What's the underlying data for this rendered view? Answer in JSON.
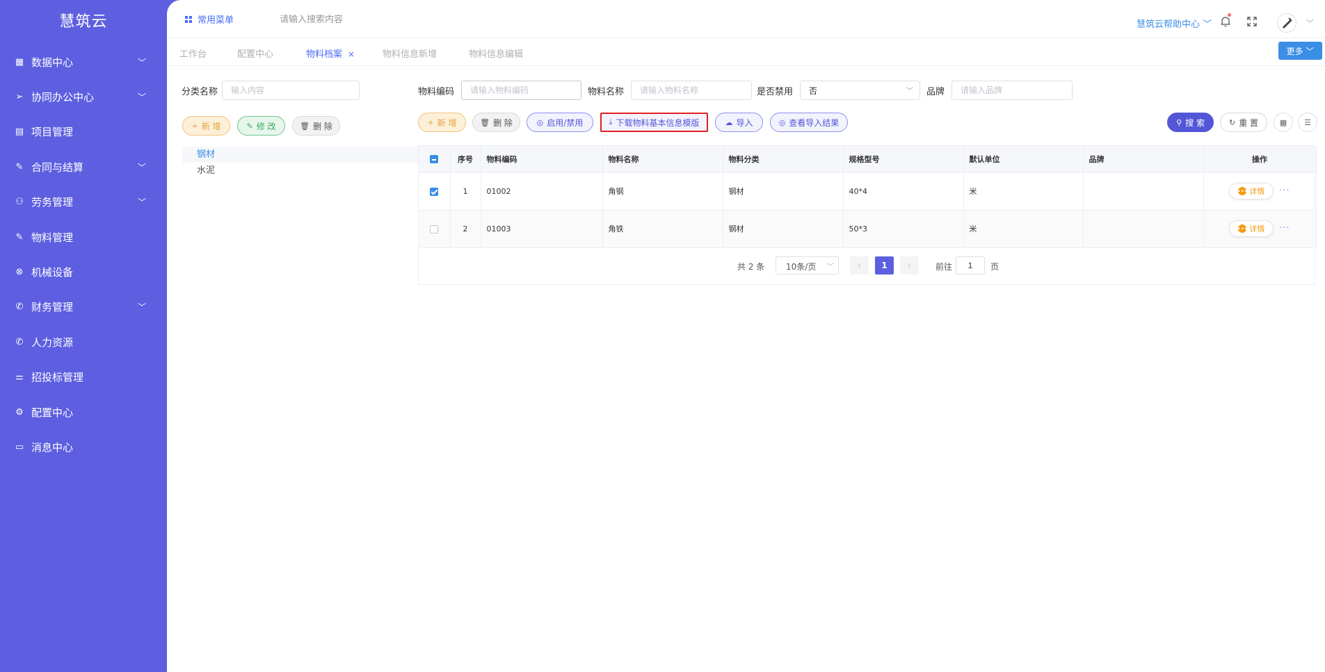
{
  "brand": "慧筑云",
  "sidebar": {
    "items": [
      {
        "label": "数据中心",
        "icon": "grid-icon",
        "glyph": "▦",
        "arrow": true
      },
      {
        "label": "协同办公中心",
        "icon": "send-icon",
        "glyph": "➢",
        "arrow": true
      },
      {
        "label": "项目管理",
        "icon": "book-icon",
        "glyph": "▤",
        "arrow": false
      },
      {
        "label": "合同与结算",
        "icon": "edit-icon",
        "glyph": "✎",
        "arrow": true
      },
      {
        "label": "劳务管理",
        "icon": "user-icon",
        "glyph": "⚇",
        "arrow": true
      },
      {
        "label": "物料管理",
        "icon": "edit-icon",
        "glyph": "✎",
        "arrow": false
      },
      {
        "label": "机械设备",
        "icon": "close-circle-icon",
        "glyph": "⊗",
        "arrow": false
      },
      {
        "label": "财务管理",
        "icon": "phone-icon",
        "glyph": "✆",
        "arrow": true
      },
      {
        "label": "人力资源",
        "icon": "phone-icon",
        "glyph": "✆",
        "arrow": false
      },
      {
        "label": "招投标管理",
        "icon": "sliders-icon",
        "glyph": "⚌",
        "arrow": false
      },
      {
        "label": "配置中心",
        "icon": "gear-icon",
        "glyph": "⚙",
        "arrow": false
      },
      {
        "label": "消息中心",
        "icon": "message-icon",
        "glyph": "▭",
        "arrow": false
      }
    ]
  },
  "topbar": {
    "common_menu": "常用菜单",
    "search_placeholder": "请输入搜索内容",
    "help": "慧筑云帮助中心 ﹀"
  },
  "tabs": [
    {
      "label": "工作台",
      "active": false
    },
    {
      "label": "配置中心",
      "active": false
    },
    {
      "label": "物料档案",
      "active": true,
      "closable": true
    },
    {
      "label": "物料信息新增",
      "active": false
    },
    {
      "label": "物料信息编辑",
      "active": false
    }
  ],
  "tab_close": "×",
  "more_button": "更多 ﹀",
  "left": {
    "filter_label": "分类名称",
    "filter_placeholder": "输入内容",
    "add": "新 增",
    "edit": "修 改",
    "delete": "删 除",
    "tree": [
      "钢材",
      "水泥"
    ]
  },
  "filters": {
    "code_label": "物料编码",
    "code_placeholder": "请输入物料编码",
    "name_label": "物料名称",
    "name_placeholder": "请输入物料名称",
    "disabled_label": "是否禁用",
    "disabled_value": "否",
    "brand_label": "品牌",
    "brand_placeholder": "请输入品牌"
  },
  "toolbar": {
    "add": "新 增",
    "delete": "删 除",
    "toggle": "启用/禁用",
    "download": "下载物料基本信息模版",
    "import": "导入",
    "view_import": "查看导入结果",
    "search": "搜 索",
    "reset": "重 置"
  },
  "table": {
    "headers": [
      "序号",
      "物料编码",
      "物料名称",
      "物料分类",
      "规格型号",
      "默认单位",
      "品牌",
      "操作"
    ],
    "rows": [
      {
        "index": "1",
        "code": "01002",
        "name": "角钢",
        "category": "钢材",
        "spec": "40*4",
        "unit": "米",
        "brand": "",
        "checked": true
      },
      {
        "index": "2",
        "code": "01003",
        "name": "角铁",
        "category": "钢材",
        "spec": "50*3",
        "unit": "米",
        "brand": "",
        "checked": false
      }
    ],
    "detail_label": "详情",
    "more_label": "···"
  },
  "pagination": {
    "total": "共 2 条",
    "page_size": "10条/页",
    "current_page": "1",
    "goto_label": "前往",
    "goto_value": "1",
    "page_suffix": "页"
  },
  "colors": {
    "sidebar": "#5d5fe0",
    "accent": "#4a6cf7",
    "highlight_border": "#e02020"
  }
}
